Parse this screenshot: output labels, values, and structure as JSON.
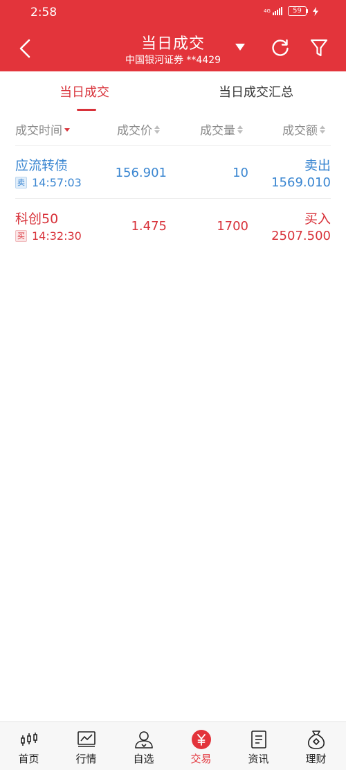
{
  "status_bar": {
    "time": "2:58",
    "network": "4G",
    "battery": "59"
  },
  "header": {
    "title": "当日成交",
    "subtitle": "中国银河证券 **4429"
  },
  "tabs": [
    {
      "label": "当日成交",
      "active": true
    },
    {
      "label": "当日成交汇总",
      "active": false
    }
  ],
  "columns": [
    "成交时间",
    "成交价",
    "成交量",
    "成交额"
  ],
  "trades": [
    {
      "name": "应流转债",
      "side_badge": "卖",
      "time": "14:57:03",
      "price": "156.901",
      "qty": "10",
      "action": "卖出",
      "amount": "1569.010",
      "side": "sell"
    },
    {
      "name": "科创50",
      "side_badge": "买",
      "time": "14:32:30",
      "price": "1.475",
      "qty": "1700",
      "action": "买入",
      "amount": "2507.500",
      "side": "buy"
    }
  ],
  "bottom_nav": [
    {
      "label": "首页",
      "icon": "candlestick-icon"
    },
    {
      "label": "行情",
      "icon": "trend-chart-icon"
    },
    {
      "label": "自选",
      "icon": "user-icon"
    },
    {
      "label": "交易",
      "icon": "yuan-icon",
      "active": true
    },
    {
      "label": "资讯",
      "icon": "document-icon"
    },
    {
      "label": "理财",
      "icon": "money-bag-icon"
    }
  ],
  "colors": {
    "brand_red": "#e3343b",
    "sell_blue": "#3a86d1",
    "buy_red": "#d8323a"
  }
}
